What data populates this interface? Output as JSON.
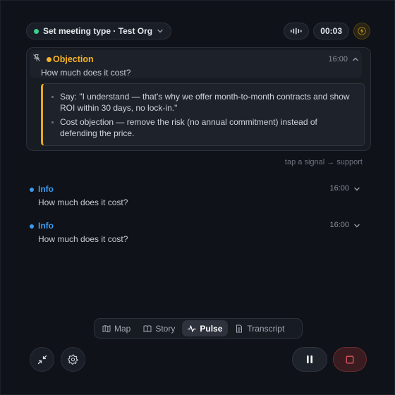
{
  "header": {
    "meeting_label": "Set meeting type · Test Org",
    "timer": "00:03"
  },
  "objection": {
    "title": "Objection",
    "time": "16:00",
    "question": "How much does it cost?",
    "support": [
      "Say: \"I understand — that's why we offer month-to-month contracts and show ROI within 30 days, no lock-in.\"",
      "Cost objection — remove the risk (no annual commitment) instead of defending the price."
    ]
  },
  "hint": "tap a signal → support",
  "signals": [
    {
      "title": "Info",
      "time": "16:00",
      "text": "How much does it cost?"
    },
    {
      "title": "Info",
      "time": "16:00",
      "text": "How much does it cost?"
    }
  ],
  "tabs": [
    {
      "label": "Map",
      "icon": "map-icon"
    },
    {
      "label": "Story",
      "icon": "book-icon"
    },
    {
      "label": "Pulse",
      "icon": "pulse-icon",
      "active": true
    },
    {
      "label": "Transcript",
      "icon": "document-icon"
    }
  ],
  "colors": {
    "accent_amber": "#f5b324",
    "accent_blue": "#3a9bf0",
    "status_green": "#3ecf8e",
    "stop_red": "#e05561"
  }
}
